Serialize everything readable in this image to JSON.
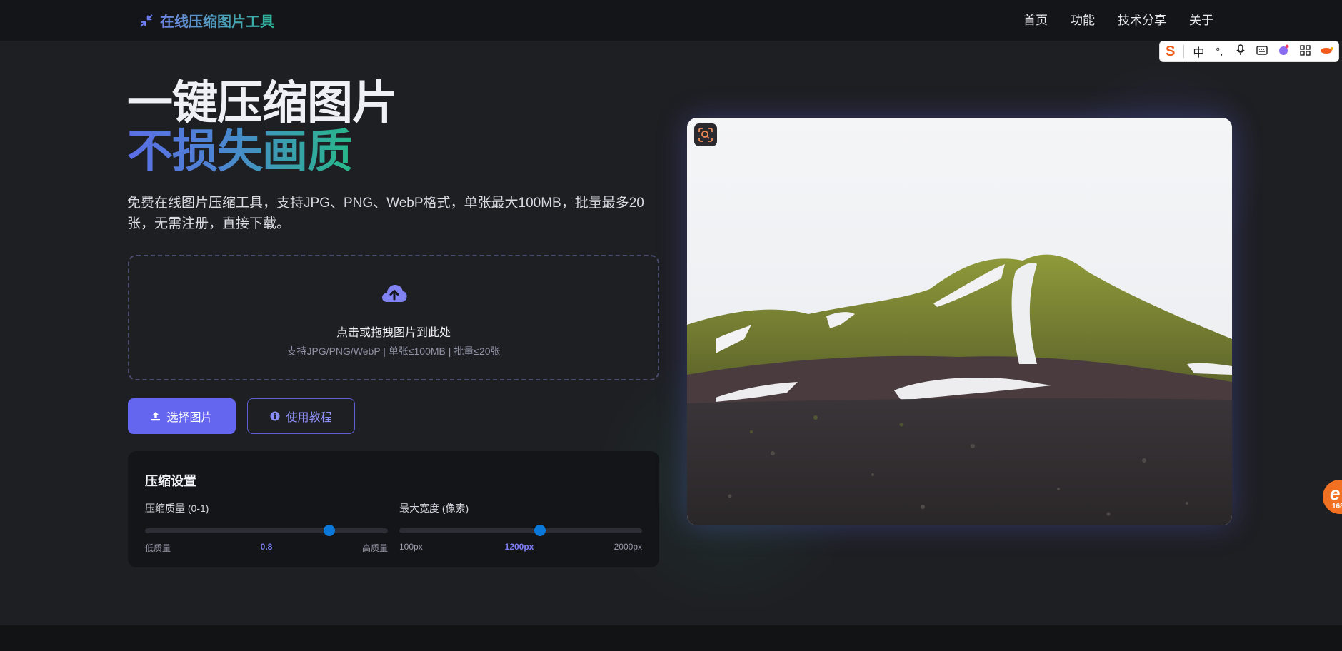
{
  "header": {
    "brand": "在线压缩图片工具",
    "nav": [
      "首页",
      "功能",
      "技术分享",
      "关于"
    ]
  },
  "ime_toolbar": {
    "mode": "中",
    "icons": [
      "sogou-logo",
      "punctuation-icon",
      "microphone-icon",
      "keyboard-icon",
      "skin-icon",
      "grid-icon",
      "more-icon"
    ]
  },
  "hero": {
    "title_line1": "一键压缩图片",
    "title_line2": "不损失画质",
    "description": "免费在线图片压缩工具，支持JPG、PNG、WebP格式，单张最大100MB，批量最多20张，无需注册，直接下载。"
  },
  "upload": {
    "title": "点击或拖拽图片到此处",
    "subtitle": "支持JPG/PNG/WebP | 单张≤100MB | 批量≤20张"
  },
  "buttons": {
    "select": "选择图片",
    "tutorial": "使用教程"
  },
  "settings": {
    "title": "压缩设置",
    "quality": {
      "label": "压缩质量 (0-1)",
      "min_label": "低质量",
      "value": "0.8",
      "max_label": "高质量",
      "fraction": 0.76
    },
    "width": {
      "label": "最大宽度 (像素)",
      "min_label": "100px",
      "value": "1200px",
      "max_label": "2000px",
      "fraction": 0.579
    }
  },
  "side_badge": {
    "number": "168"
  },
  "colors": {
    "accent": "#6566ef",
    "slider_thumb": "#0a78d8",
    "gradient_start": "#5b6ee6",
    "gradient_end": "#27b889"
  }
}
